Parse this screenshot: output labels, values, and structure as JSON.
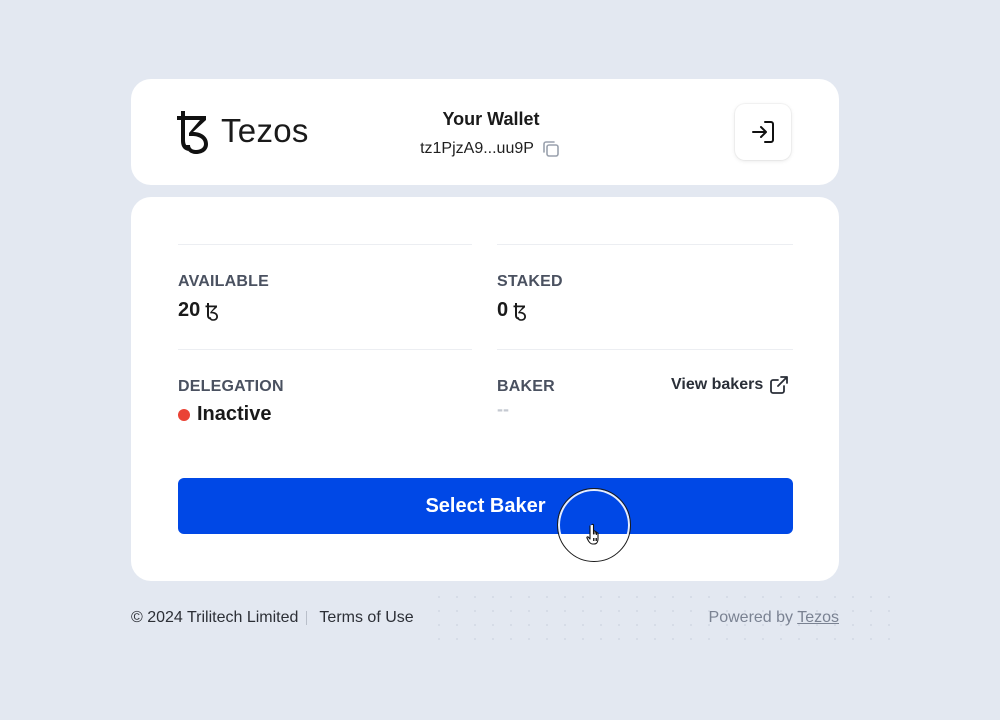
{
  "header": {
    "brand": "Tezos",
    "wallet_title": "Your Wallet",
    "wallet_address": "tz1PjzA9...uu9P"
  },
  "stats": {
    "available_label": "AVAILABLE",
    "available_value": "20",
    "staked_label": "STAKED",
    "staked_value": "0",
    "delegation_label": "DELEGATION",
    "delegation_status": "Inactive",
    "baker_label": "BAKER",
    "baker_value": "--",
    "view_bakers_label": "View bakers"
  },
  "actions": {
    "select_baker_label": "Select Baker"
  },
  "footer": {
    "copyright": "© 2024 Trilitech Limited",
    "terms_label": "Terms of Use",
    "powered_by": "Powered by",
    "powered_by_link": "Tezos"
  },
  "colors": {
    "background": "#e3e8f1",
    "primary_button": "#0048e6",
    "status_inactive": "#ea4335"
  },
  "icons": {
    "brand": "tezos-logo-icon",
    "copy": "copy-icon",
    "logout": "sign-in-arrow-icon",
    "currency": "tez-currency-icon",
    "external": "external-link-icon",
    "cursor": "hand-pointer-icon"
  }
}
